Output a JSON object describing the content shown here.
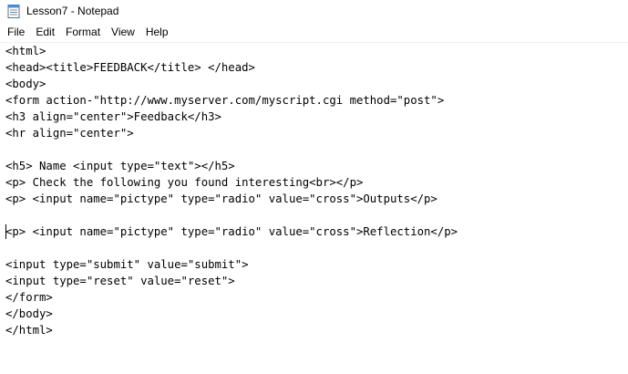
{
  "window": {
    "title": "Lesson7 - Notepad",
    "app_icon": "notepad-icon"
  },
  "menu": [
    {
      "label": "File"
    },
    {
      "label": "Edit"
    },
    {
      "label": "Format"
    },
    {
      "label": "View"
    },
    {
      "label": "Help"
    }
  ],
  "editor": {
    "caret_line": 11,
    "lines": [
      "<html>",
      "<head><title>FEEDBACK</title> </head>",
      "<body>",
      "<form action-\"http://www.myserver.com/myscript.cgi method=\"post\">",
      "<h3 align=\"center\">Feedback</h3>",
      "<hr align=\"center\">",
      "",
      "<h5> Name <input type=\"text\"></h5>",
      "<p> Check the following you found interesting<br></p>",
      "<p> <input name=\"pictype\" type=\"radio\" value=\"cross\">Outputs</p>",
      "",
      "<p> <input name=\"pictype\" type=\"radio\" value=\"cross\">Reflection</p>",
      "",
      "<input type=\"submit\" value=\"submit\">",
      "<input type=\"reset\" value=\"reset\">",
      "</form>",
      "</body>",
      "</html>"
    ]
  }
}
